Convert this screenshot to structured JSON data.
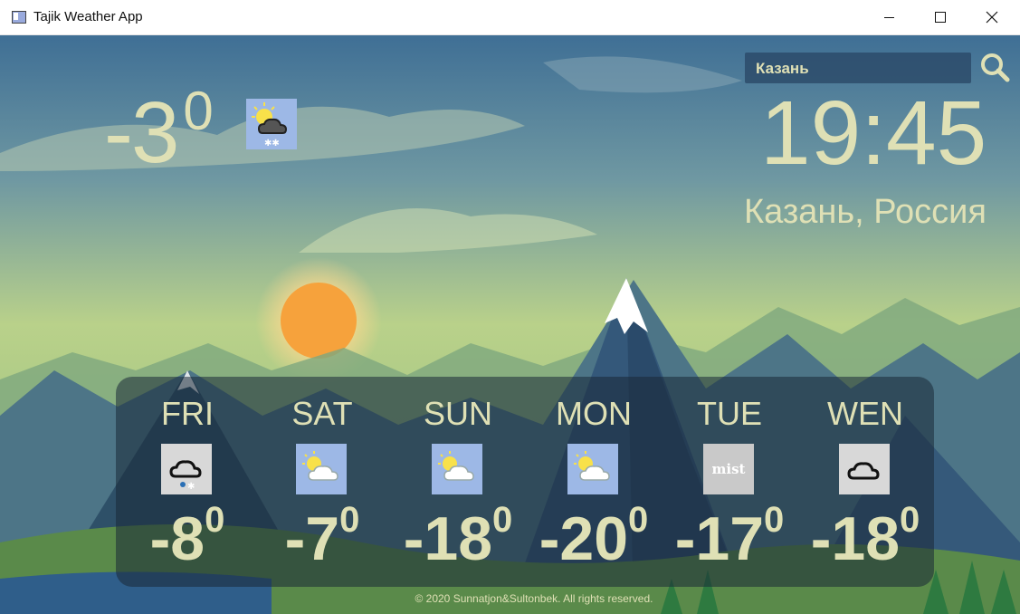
{
  "window": {
    "title": "Tajik Weather App",
    "minimize": "—",
    "maximize": "☐",
    "close": "✕"
  },
  "search": {
    "value": "Казань",
    "placeholder": ""
  },
  "current": {
    "temperature": "-3",
    "degree": "0",
    "icon": "partly-cloudy-snow-icon"
  },
  "time": "19:45",
  "location": "Казань, Россия",
  "forecast": [
    {
      "day": "FRI",
      "temp": "-8",
      "deg": "0",
      "icon": "cloud-sleet-icon"
    },
    {
      "day": "SAT",
      "temp": "-7",
      "deg": "0",
      "icon": "partly-cloudy-icon"
    },
    {
      "day": "SUN",
      "temp": "-18",
      "deg": "0",
      "icon": "partly-cloudy-icon"
    },
    {
      "day": "MON",
      "temp": "-20",
      "deg": "0",
      "icon": "partly-cloudy-icon"
    },
    {
      "day": "TUE",
      "temp": "-17",
      "deg": "0",
      "icon": "mist-icon",
      "icon_text": "mist"
    },
    {
      "day": "WEN",
      "temp": "-18",
      "deg": "0",
      "icon": "cloud-icon"
    }
  ],
  "footer": "© 2020 Sunnatjon&Sultonbek. All rights reserved.",
  "colors": {
    "text": "#dfe0b5",
    "sky_top": "#3f6f95",
    "sky_mid": "#b9d18a",
    "sun": "#f6a23c"
  }
}
